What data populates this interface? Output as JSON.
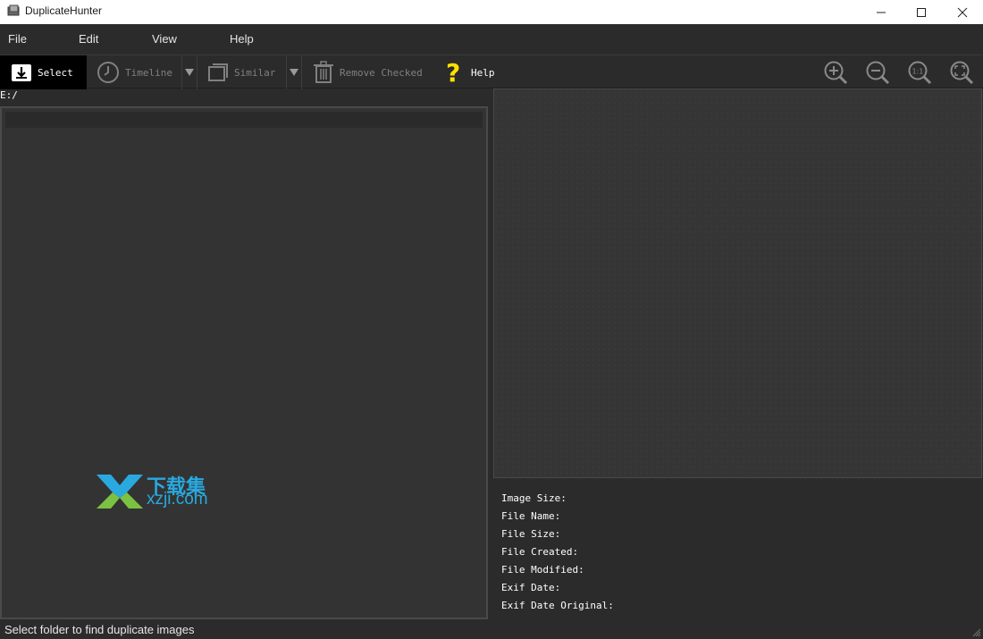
{
  "window": {
    "title": "DuplicateHunter"
  },
  "menu": {
    "items": [
      "File",
      "Edit",
      "View",
      "Help"
    ]
  },
  "toolbar": {
    "select": "Select",
    "timeline": "Timeline",
    "similar": "Similar",
    "remove_checked": "Remove Checked",
    "help": "Help",
    "zoom_in_icon": "zoom-in-icon",
    "zoom_out_icon": "zoom-out-icon",
    "actual_size_icon": "actual-size-icon",
    "fit_icon": "fit-to-window-icon",
    "help_color": "#ffe000"
  },
  "path": "E:/",
  "watermark": {
    "cn": "下载集",
    "en": "xzji.com"
  },
  "info": {
    "image_size": "Image Size:",
    "file_name": "File Name:",
    "file_size": "File Size:",
    "file_created": "File Created:",
    "file_modified": "File Modified:",
    "exif_date": "Exif Date:",
    "exif_date_original": "Exif Date Original:"
  },
  "status": "Select folder to find duplicate images"
}
